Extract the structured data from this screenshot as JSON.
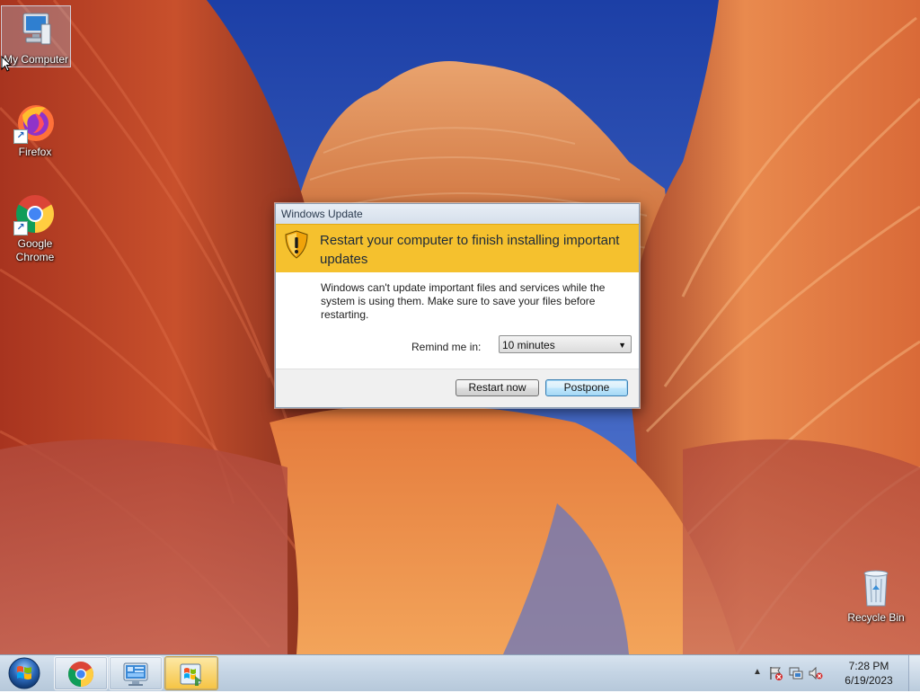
{
  "desktop": {
    "icons": [
      {
        "label": "My Computer",
        "icon": "computer-icon",
        "selected": true
      },
      {
        "label": "Firefox",
        "icon": "firefox-icon"
      },
      {
        "label": "Google Chrome",
        "icon": "chrome-icon"
      },
      {
        "label": "Recycle Bin",
        "icon": "recycle-bin-icon"
      }
    ]
  },
  "dialog": {
    "title": "Windows Update",
    "headline": "Restart your computer to finish installing important updates",
    "message": "Windows can't update important files and services while the system is using them. Make sure to save your files before restarting.",
    "remind_label": "Remind me in:",
    "remind_value": "10 minutes",
    "buttons": {
      "restart": "Restart now",
      "postpone": "Postpone"
    },
    "banner_color": "#f5c12e",
    "icon": "shield-warning-icon"
  },
  "taskbar": {
    "items": [
      {
        "icon": "start-orb-icon"
      },
      {
        "icon": "chrome-icon"
      },
      {
        "icon": "control-panel-icon"
      },
      {
        "icon": "windows-update-icon",
        "active": true
      }
    ],
    "tray": {
      "icons": [
        "show-hidden-icons-arrow",
        "action-center-icon",
        "network-icon",
        "volume-muted-icon"
      ],
      "time": "7:28 PM",
      "date": "6/19/2023"
    }
  }
}
